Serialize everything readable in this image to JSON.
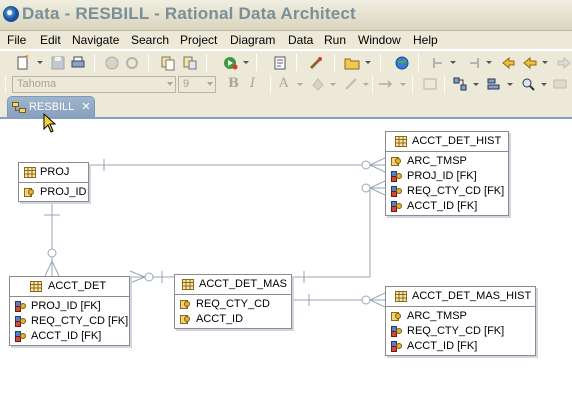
{
  "window": {
    "title": "Data - RESBILL - Rational Data Architect"
  },
  "menu": [
    "File",
    "Edit",
    "Navigate",
    "Search",
    "Project",
    "Diagram",
    "Data",
    "Run",
    "Window",
    "Help"
  ],
  "format_toolbar": {
    "font_name": "Tahoma",
    "font_size": "9",
    "bold_label": "B",
    "italic_label": "I",
    "font_color_label": "A"
  },
  "editor_tab": {
    "label": "RESBILL",
    "close_label": "✕"
  },
  "diagram": {
    "entities": [
      {
        "name": "PROJ",
        "columns": [
          {
            "label": "PROJ_ID",
            "icon": "primary-key-icon"
          }
        ]
      },
      {
        "name": "ACCT_DET",
        "columns": [
          {
            "label": "PROJ_ID [FK]",
            "icon": "foreign-key-icon"
          },
          {
            "label": "REQ_CTY_CD [FK]",
            "icon": "foreign-key-icon"
          },
          {
            "label": "ACCT_ID [FK]",
            "icon": "foreign-key-icon"
          }
        ]
      },
      {
        "name": "ACCT_DET_MAS",
        "columns": [
          {
            "label": "REQ_CTY_CD",
            "icon": "primary-key-icon"
          },
          {
            "label": "ACCT_ID",
            "icon": "primary-key-icon"
          }
        ]
      },
      {
        "name": "ACCT_DET_HIST",
        "columns": [
          {
            "label": "ARC_TMSP",
            "icon": "primary-key-icon"
          },
          {
            "label": "PROJ_ID [FK]",
            "icon": "foreign-key-icon"
          },
          {
            "label": "REQ_CTY_CD [FK]",
            "icon": "foreign-key-icon"
          },
          {
            "label": "ACCT_ID [FK]",
            "icon": "foreign-key-icon"
          }
        ]
      },
      {
        "name": "ACCT_DET_MAS_HIST",
        "columns": [
          {
            "label": "ARC_TMSP",
            "icon": "primary-key-icon"
          },
          {
            "label": "REQ_CTY_CD [FK]",
            "icon": "foreign-key-icon"
          },
          {
            "label": "ACCT_ID [FK]",
            "icon": "foreign-key-icon"
          }
        ]
      }
    ]
  },
  "colors": {
    "tab_active": "#86a0bf",
    "relationship_line": "#9aa6b6",
    "table_icon": "#c89b3c"
  }
}
